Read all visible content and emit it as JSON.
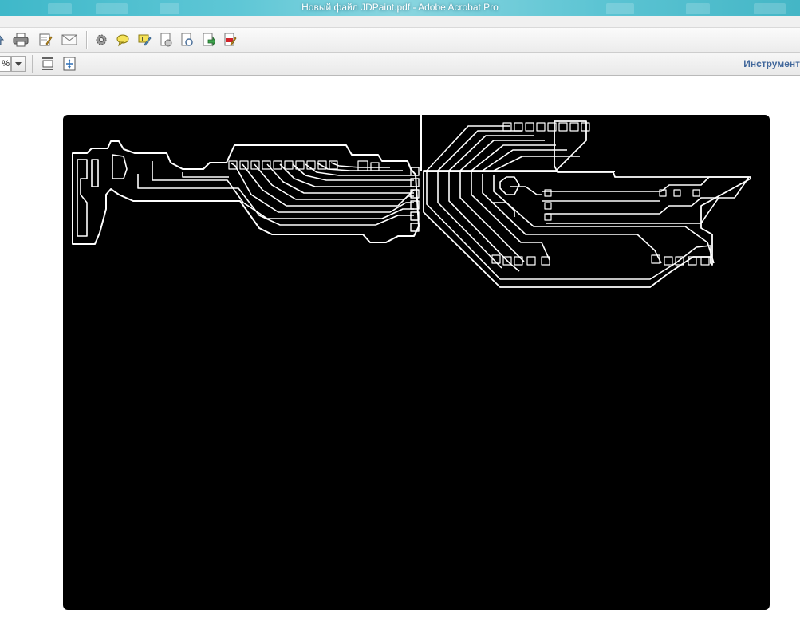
{
  "window": {
    "title": "Новый файл JDPaint.pdf - Adobe Acrobat Pro"
  },
  "toolbar": {
    "zoom_value": "%",
    "tools_label": "Инструмент"
  },
  "icons": [
    "upload-icon",
    "print-icon",
    "edit-icon",
    "email-icon",
    "gear-icon",
    "comment-icon",
    "highlight-icon",
    "stamp-icon",
    "security-icon",
    "export-icon",
    "pdf-edit-icon",
    "fit-width-icon",
    "fit-page-icon"
  ],
  "colors": {
    "titlebar": "#4fc0cf",
    "tools_label": "#41679b",
    "page": "#000000",
    "traces": "#ffffff"
  }
}
